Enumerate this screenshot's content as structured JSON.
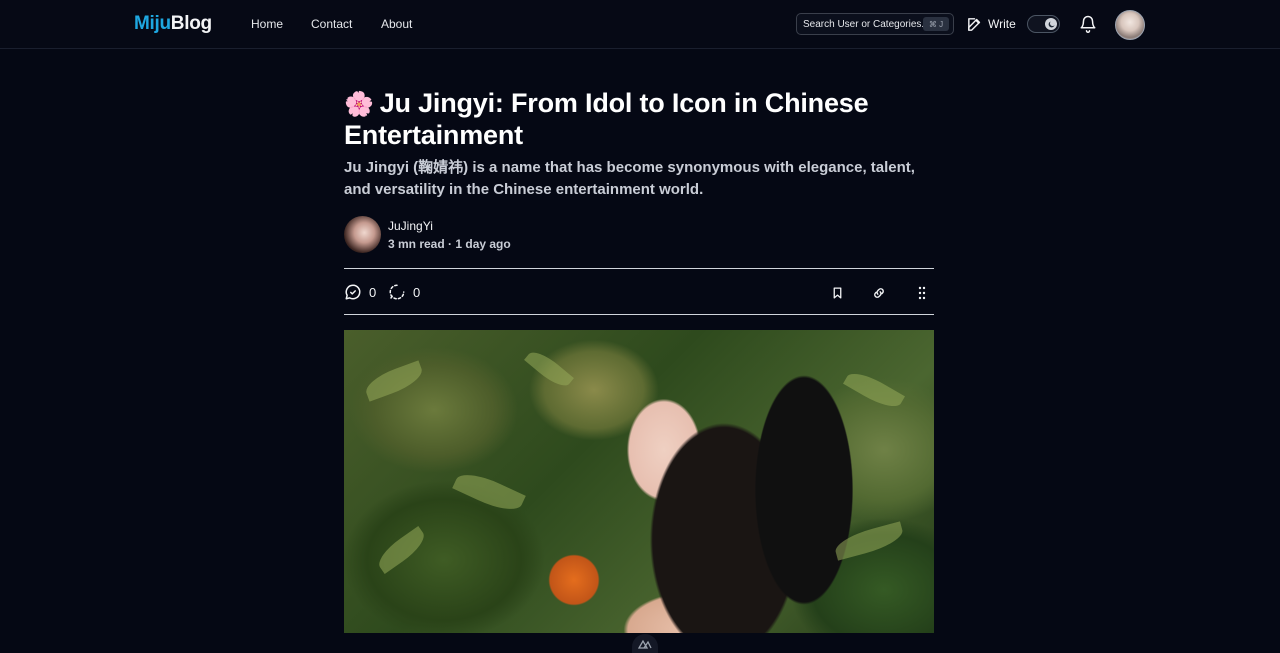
{
  "nav": {
    "logo_part1": "Miju",
    "logo_part2": "Blog",
    "links": [
      "Home",
      "Contact",
      "About"
    ],
    "search_placeholder": "Search User or Categories...",
    "search_shortcut": "⌘ J",
    "write_label": "Write"
  },
  "article": {
    "emoji": "🌸",
    "title": "Ju Jingyi: From Idol to Icon in Chinese Entertainment",
    "subtitle": "Ju Jingyi (鞠婧祎) is a name that has become synonymous with elegance, talent, and versatility in the Chinese entertainment world.",
    "author_name": "JuJingYi",
    "meta": "3 mn read · 1 day ago",
    "comments_count": "0",
    "reposts_count": "0"
  },
  "colors": {
    "background": "#050814",
    "accent": "#1ea7e0"
  },
  "icons": [
    "edit-icon",
    "theme-toggle-moon-icon",
    "bell-icon",
    "comment-icon",
    "repost-icon",
    "bookmark-icon",
    "link-icon",
    "more-icon"
  ]
}
